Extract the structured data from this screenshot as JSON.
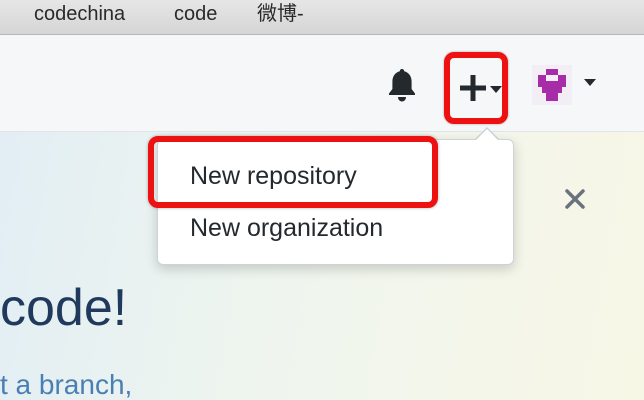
{
  "bookmarks": [
    "codechina",
    "code",
    "微博-"
  ],
  "header": {
    "notifications_icon": "bell-icon",
    "new_menu_icon": "plus-icon",
    "avatar_icon": "identicon"
  },
  "dropdown": {
    "items": [
      "New repository",
      "New organization"
    ],
    "highlighted": "New repository"
  },
  "page": {
    "headline": "code!",
    "subline": "t a branch,",
    "close_icon": "close-icon"
  },
  "colors": {
    "highlight": "#ee1111",
    "headline": "#1f3a5c",
    "subline": "#4a7fb3",
    "avatar": "#a62ca8"
  }
}
